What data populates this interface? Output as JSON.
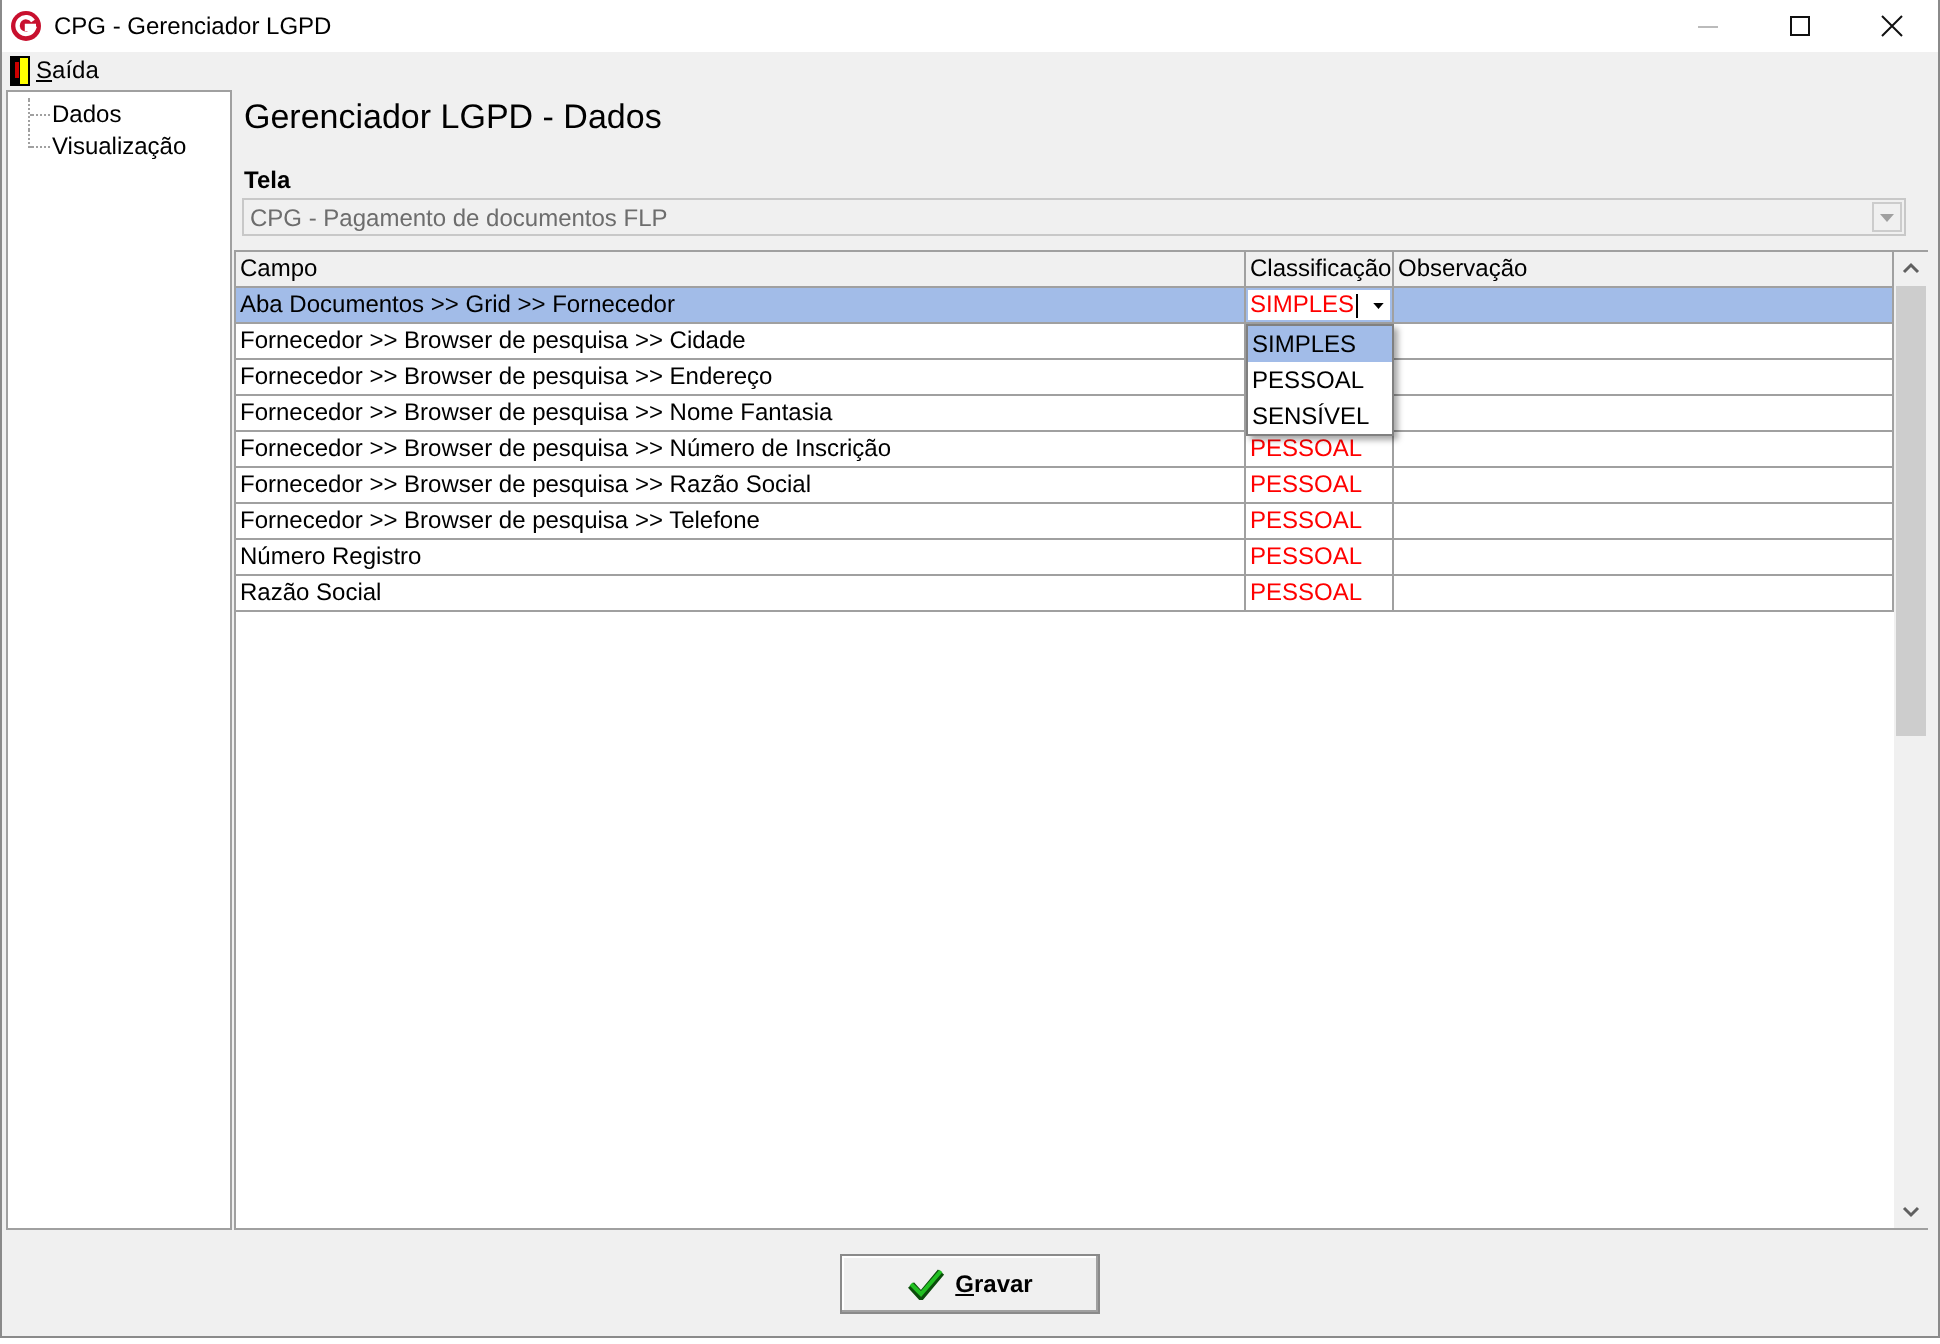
{
  "window": {
    "title": "CPG - Gerenciador LGPD"
  },
  "menu": [
    {
      "label": "Saída",
      "first_letter_underlined": true
    }
  ],
  "sidebar": {
    "items": [
      {
        "label": "Dados"
      },
      {
        "label": "Visualização"
      }
    ]
  },
  "heading": "Gerenciador LGPD - Dados",
  "tela": {
    "label": "Tela",
    "value": "CPG - Pagamento de documentos FLP",
    "disabled": true
  },
  "table": {
    "columns": [
      "Campo",
      "Classificação",
      "Observação"
    ],
    "rows": [
      {
        "campo": "Aba Documentos >> Grid >> Fornecedor",
        "classificacao": "SIMPLES",
        "selected": true,
        "editing": true,
        "dropdown": {
          "options": [
            {
              "label": "SIMPLES",
              "selected": true
            },
            {
              "label": "PESSOAL",
              "selected": false
            },
            {
              "label": "SENSÍVEL",
              "selected": false
            }
          ]
        }
      },
      {
        "campo": "Fornecedor >> Browser de pesquisa >> Cidade",
        "selected": false,
        "editing": false
      },
      {
        "campo": "Fornecedor >> Browser de pesquisa >> Endereço",
        "selected": false,
        "editing": false
      },
      {
        "campo": "Fornecedor >> Browser de pesquisa >> Nome Fantasia",
        "selected": false,
        "editing": false
      },
      {
        "campo": "Fornecedor >> Browser de pesquisa >> Número de Inscrição",
        "classificacao": "PESSOAL",
        "selected": false,
        "editing": false
      },
      {
        "campo": "Fornecedor >> Browser de pesquisa >> Razão Social",
        "classificacao": "PESSOAL",
        "selected": false,
        "editing": false
      },
      {
        "campo": "Fornecedor >> Browser de pesquisa >> Telefone",
        "classificacao": "PESSOAL",
        "selected": false,
        "editing": false
      },
      {
        "campo": "Número Registro",
        "classificacao": "PESSOAL",
        "selected": false,
        "editing": false
      },
      {
        "campo": "Razão Social",
        "classificacao": "PESSOAL",
        "selected": false,
        "editing": false
      }
    ]
  },
  "buttons": [
    {
      "label": "Gravar",
      "first_letter_underlined": true
    }
  ]
}
